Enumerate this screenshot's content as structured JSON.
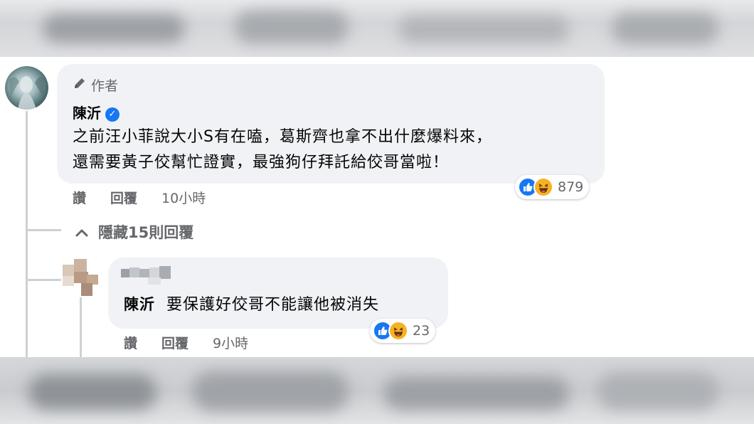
{
  "comment": {
    "author_badge": "作者",
    "author_name": "陳沂",
    "text_line1": "之前汪小菲說大小S有在嗑，葛斯齊也拿不出什麼爆料來，",
    "text_line2": "還需要黃子佼幫忙證實，最強狗仔拜託給佼哥當啦！",
    "actions": {
      "like": "讚",
      "reply": "回覆",
      "time": "10小時"
    },
    "reactions": {
      "icons": [
        "like-icon",
        "haha-icon"
      ],
      "count": "879"
    }
  },
  "hide_replies": {
    "label": "隱藏15則回覆",
    "icon": "chevron-up-icon"
  },
  "reply": {
    "mention": "陳沂",
    "text": "要保護好佼哥不能讓他被消失",
    "actions": {
      "like": "讚",
      "reply": "回覆",
      "time": "9小時"
    },
    "reactions": {
      "icons": [
        "like-icon",
        "haha-icon"
      ],
      "count": "23"
    }
  },
  "colors": {
    "bubble": "#f0f2f5",
    "secondary_text": "#65676b",
    "like_blue": "#1877f2",
    "haha_yellow": "#f7b125"
  }
}
